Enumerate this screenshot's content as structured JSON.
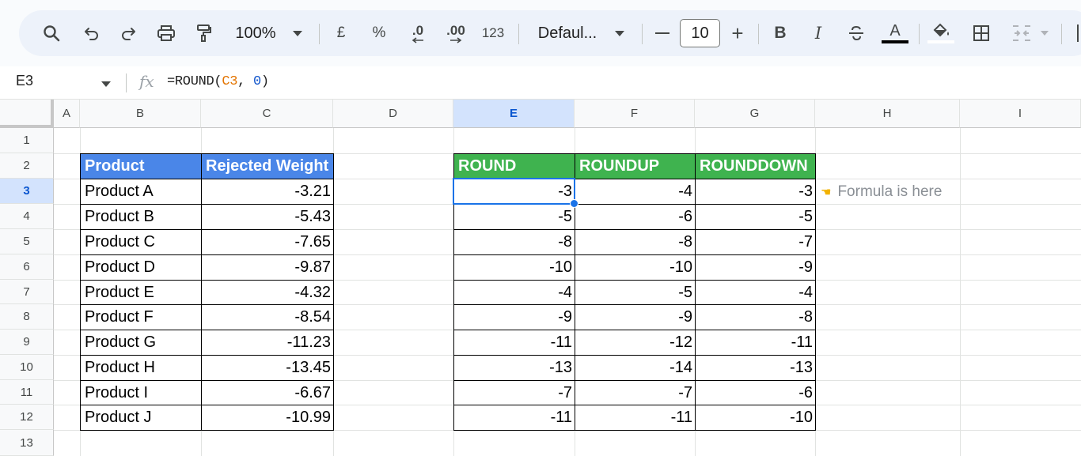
{
  "toolbar": {
    "zoom": "100%",
    "currency": "£",
    "percent": "%",
    "decrease_decimal": ".0",
    "increase_decimal": ".00",
    "number_format": "123",
    "font": "Defaul...",
    "font_size": "10",
    "minus": "—",
    "plus": "+",
    "bold": "B",
    "italic": "I",
    "text_color_letter": "A"
  },
  "formula_bar": {
    "cell_ref": "E3",
    "fx": "fx",
    "formula_prefix": "=ROUND(",
    "formula_ref": "C3",
    "formula_sep": ", ",
    "formula_num": "0",
    "formula_suffix": ")"
  },
  "columns": [
    "A",
    "B",
    "C",
    "D",
    "E",
    "F",
    "G",
    "H",
    "I"
  ],
  "rows": [
    "1",
    "2",
    "3",
    "4",
    "5",
    "6",
    "7",
    "8",
    "9",
    "10",
    "11",
    "12",
    "13"
  ],
  "selected": {
    "column": "E",
    "row": "3"
  },
  "table1": {
    "headers": [
      "Product",
      "Rejected Weight"
    ],
    "rows": [
      [
        "Product A",
        "-3.21"
      ],
      [
        "Product B",
        "-5.43"
      ],
      [
        "Product C",
        "-7.65"
      ],
      [
        "Product D",
        "-9.87"
      ],
      [
        "Product E",
        "-4.32"
      ],
      [
        "Product F",
        "-8.54"
      ],
      [
        "Product G",
        "-11.23"
      ],
      [
        "Product H",
        "-13.45"
      ],
      [
        "Product I",
        "-6.67"
      ],
      [
        "Product J",
        "-10.99"
      ]
    ]
  },
  "table2": {
    "headers": [
      "ROUND",
      "ROUNDUP",
      "ROUNDDOWN"
    ],
    "rows": [
      [
        "-3",
        "-4",
        "-3"
      ],
      [
        "-5",
        "-6",
        "-5"
      ],
      [
        "-8",
        "-8",
        "-7"
      ],
      [
        "-10",
        "-10",
        "-9"
      ],
      [
        "-4",
        "-5",
        "-4"
      ],
      [
        "-9",
        "-9",
        "-8"
      ],
      [
        "-11",
        "-12",
        "-11"
      ],
      [
        "-13",
        "-14",
        "-13"
      ],
      [
        "-7",
        "-7",
        "-6"
      ],
      [
        "-11",
        "-11",
        "-10"
      ]
    ]
  },
  "note": {
    "hand": "☚",
    "text": "Formula is here"
  },
  "colors": {
    "blue_header": "#4a86e8",
    "green_header": "#3fb34f",
    "selection": "#1a73e8"
  }
}
